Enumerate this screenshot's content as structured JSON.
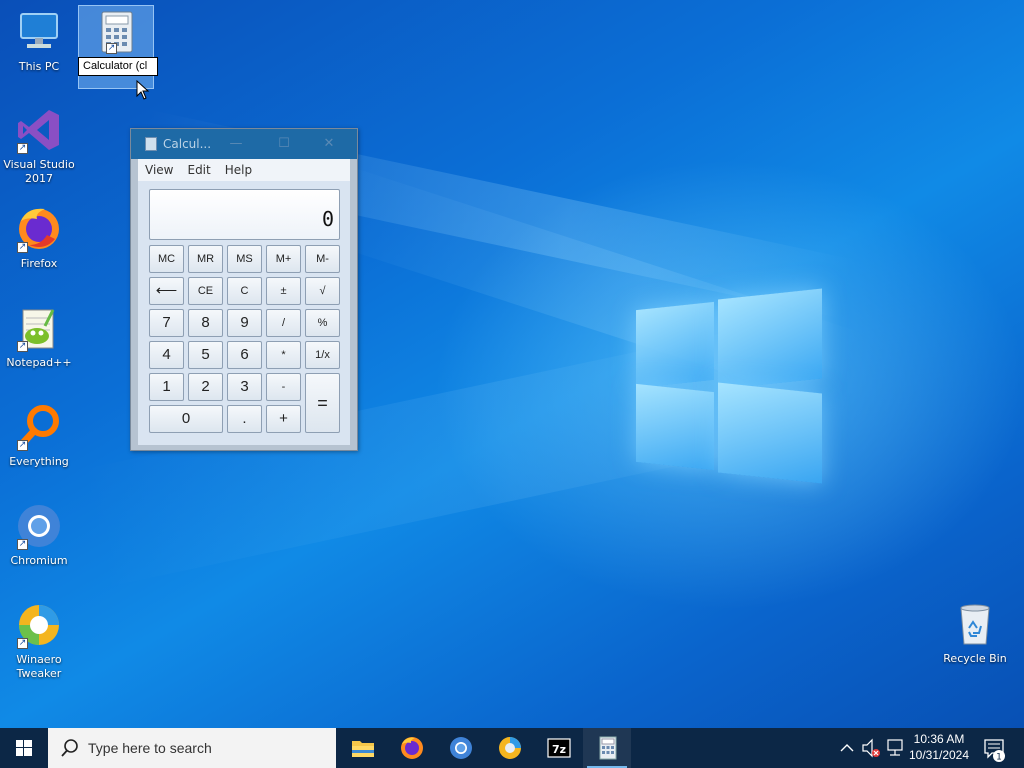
{
  "desktop": {
    "icons": [
      {
        "label": "This PC"
      },
      {
        "label": "Calculator (cl"
      },
      {
        "label": "Visual Studio 2017"
      },
      {
        "label": "Firefox"
      },
      {
        "label": "Notepad++"
      },
      {
        "label": "Everything"
      },
      {
        "label": "Chromium"
      },
      {
        "label": "Winaero Tweaker"
      },
      {
        "label": "Recycle Bin"
      }
    ],
    "rename_value": "Calculator (cl"
  },
  "calculator": {
    "title": "Calcul...",
    "menu": [
      "View",
      "Edit",
      "Help"
    ],
    "display": "0",
    "buttons": {
      "mc": "MC",
      "mr": "MR",
      "ms": "MS",
      "mplus": "M+",
      "mminus": "M-",
      "back": "⟵",
      "ce": "CE",
      "c": "C",
      "plusminus": "±",
      "sqrt": "√",
      "n7": "7",
      "n8": "8",
      "n9": "9",
      "div": "/",
      "pct": "%",
      "n4": "4",
      "n5": "5",
      "n6": "6",
      "mul": "*",
      "recip": "1/x",
      "n1": "1",
      "n2": "2",
      "n3": "3",
      "sub": "-",
      "eq": "=",
      "n0": "0",
      "dot": ".",
      "add": "+"
    }
  },
  "taskbar": {
    "search_placeholder": "Type here to search",
    "time": "10:36 AM",
    "date": "10/31/2024",
    "notification_count": "1",
    "apps": [
      "File Explorer",
      "Firefox",
      "Chromium",
      "Winaero Tweaker",
      "7-Zip",
      "Calculator"
    ]
  },
  "colors": {
    "taskbar": "#0c2746",
    "calc_title": "#1e6aa6",
    "desktop_blue": "#0a6fd3"
  }
}
